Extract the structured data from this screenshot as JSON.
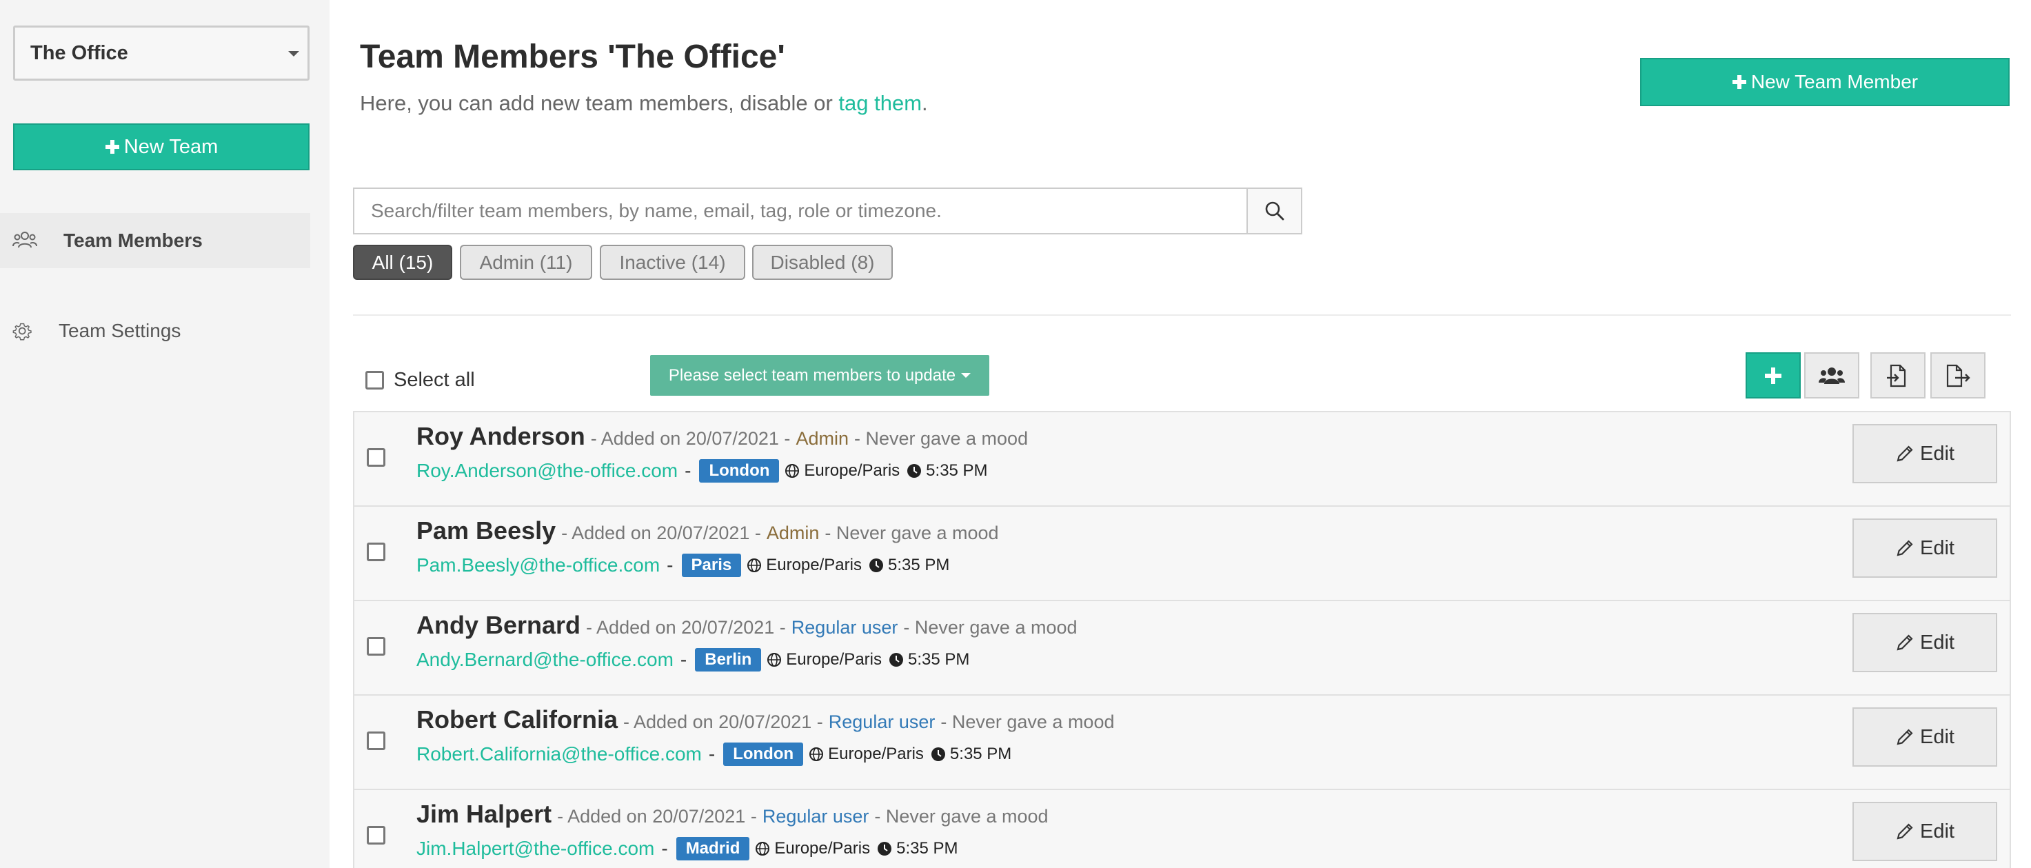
{
  "sidebar": {
    "team_select": "The Office",
    "new_team_label": "New Team",
    "nav": [
      {
        "label": "Team Members",
        "icon": "users-icon",
        "active": true
      },
      {
        "label": "Team Settings",
        "icon": "gear-icon",
        "active": false
      }
    ]
  },
  "header": {
    "title": "Team Members 'The Office'",
    "subtitle_prefix": "Here, you can add new team members, disable or ",
    "subtitle_link": "tag them",
    "subtitle_suffix": ".",
    "new_member_label": "New Team Member"
  },
  "search": {
    "placeholder": "Search/filter team members, by name, email, tag, role or timezone."
  },
  "filters": [
    {
      "label": "All (15)",
      "active": true
    },
    {
      "label": "Admin (11)",
      "active": false
    },
    {
      "label": "Inactive (14)",
      "active": false
    },
    {
      "label": "Disabled (8)",
      "active": false
    }
  ],
  "toolbar": {
    "select_all_label": "Select all",
    "bulk_label": "Please select team members to update",
    "icons": [
      "plus-icon",
      "user-group-icon",
      "file-import-icon",
      "file-export-icon"
    ]
  },
  "members": [
    {
      "name": "Roy Anderson",
      "added": "- Added on 20/07/2021 -",
      "role": "Admin",
      "mood": "- Never gave a mood",
      "email": "Roy.Anderson@the-office.com",
      "tag": "London",
      "timezone": "Europe/Paris",
      "time": "5:35 PM",
      "edit": "Edit"
    },
    {
      "name": "Pam Beesly",
      "added": "- Added on 20/07/2021 -",
      "role": "Admin",
      "mood": "- Never gave a mood",
      "email": "Pam.Beesly@the-office.com",
      "tag": "Paris",
      "timezone": "Europe/Paris",
      "time": "5:35 PM",
      "edit": "Edit"
    },
    {
      "name": "Andy Bernard",
      "added": "- Added on 20/07/2021 -",
      "role": "Regular user",
      "mood": "- Never gave a mood",
      "email": "Andy.Bernard@the-office.com",
      "tag": "Berlin",
      "timezone": "Europe/Paris",
      "time": "5:35 PM",
      "edit": "Edit"
    },
    {
      "name": "Robert California",
      "added": "- Added on 20/07/2021 -",
      "role": "Regular user",
      "mood": "- Never gave a mood",
      "email": "Robert.California@the-office.com",
      "tag": "London",
      "timezone": "Europe/Paris",
      "time": "5:35 PM",
      "edit": "Edit"
    },
    {
      "name": "Jim Halpert",
      "added": "- Added on 20/07/2021 -",
      "role": "Regular user",
      "mood": "- Never gave a mood",
      "email": "Jim.Halpert@the-office.com",
      "tag": "Madrid",
      "timezone": "Europe/Paris",
      "time": "5:35 PM",
      "edit": "Edit"
    }
  ],
  "colors": {
    "accent": "#1ebc9c",
    "tag_blue": "#2f7cc0",
    "role_admin": "#8a6d3b",
    "role_user": "#337ab7"
  }
}
